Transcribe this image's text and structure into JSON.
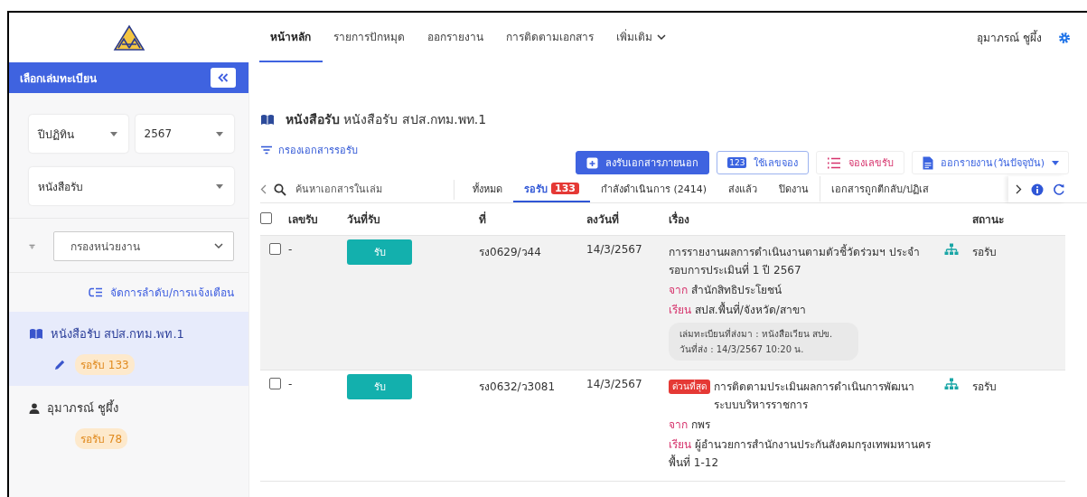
{
  "header": {
    "nav": [
      {
        "label": "หน้าหลัก",
        "selected": true,
        "dropdown": false
      },
      {
        "label": "รายการปักหมุด",
        "selected": false,
        "dropdown": false
      },
      {
        "label": "ออกรายงาน",
        "selected": false,
        "dropdown": false
      },
      {
        "label": "การติดตามเอกสาร",
        "selected": false,
        "dropdown": false
      },
      {
        "label": "เพิ่มเติม",
        "selected": false,
        "dropdown": true
      }
    ],
    "user": "อุมาภรณ์ ชูผึ้ง"
  },
  "sidebar": {
    "title": "เลือกเล่มทะเบียน",
    "selects": [
      {
        "value": "ปีปฏิทิน"
      },
      {
        "value": "2567"
      },
      {
        "value": "หนังสือรับ"
      }
    ],
    "filter": {
      "placeholder": "กรองหน่วยงาน"
    },
    "manage_link": "จัดการลำดับ/การแจ้งเตือน",
    "items": [
      {
        "kind": "book",
        "label": "หนังสือรับ สปส.กทม.พท.1",
        "badge": "รอรับ 133",
        "selected": true
      },
      {
        "kind": "person",
        "label": "อุมาภรณ์ ชูผึ้ง",
        "badge": "รอรับ 78",
        "selected": false
      }
    ]
  },
  "main": {
    "title": "**หนังสือรับ** หนังสือรับ สปส.กทม.พท.1",
    "filter_link": "กรองเอกสารรอรับ",
    "actions": [
      {
        "kind": "primary",
        "label": "ลงรับเอกสารภายนอก"
      },
      {
        "kind": "outline",
        "label": "ใช้เลขจอง",
        "icon_text": "123"
      },
      {
        "kind": "list",
        "label": "จองเลขรับ"
      },
      {
        "kind": "report",
        "label": "ออกรายงาน(วันปัจจุบัน)"
      }
    ],
    "search": {
      "placeholder": "ค้นหาเอกสารในเล่ม"
    },
    "tabs": [
      {
        "label": "ทั้งหมด",
        "selected": false
      },
      {
        "label": "รอรับ",
        "count": "133",
        "selected": true
      },
      {
        "label": "กำลังดำเนินการ (2414)",
        "selected": false
      },
      {
        "label": "ส่งแล้ว",
        "selected": false
      },
      {
        "label": "ปิดงาน",
        "selected": false
      },
      {
        "label": "เอกสารถูกตีกลับ/ปฏิเส",
        "selected": false
      }
    ],
    "table": {
      "select_all_checked": false,
      "columns": [
        "เลขรับ",
        "วันที่รับ",
        "ที่",
        "ลงวันที่",
        "เรื่อง",
        "สถานะ"
      ],
      "rows": [
        {
          "highlighted": true,
          "checked": false,
          "number": "-",
          "action": "รับ",
          "ref": "รง0629/ว44",
          "date": "14/3/2567",
          "subject": "การรายงานผลการดำเนินงานตามตัวชี้วัดร่วมฯ ประจำรอบการประเมินที่ 1 ปี 2567",
          "from_label": "จาก",
          "from": "สำนักสิทธิประโยชน์",
          "to_label": "เรียน",
          "to": "สปส.พื้นที่/จังหวัด/สาขา",
          "note": [
            "เล่มทะเบียนที่ส่งมา : หนังสือเวียน สปข.",
            "วันที่ส่ง : 14/3/2567 10:20 น."
          ],
          "status": "รอรับ"
        },
        {
          "highlighted": false,
          "checked": false,
          "number": "-",
          "action": "รับ",
          "ref": "รง0632/ว3081",
          "date": "14/3/2567",
          "urgent": "ด่วนที่สุด",
          "subject": "การติดตามประเมินผลการดำเนินการพัฒนาระบบบริหารราชการ",
          "from_label": "จาก",
          "from": "กพร",
          "to_label": "เรียน",
          "to": "ผู้อำนวยการสำนักงานประกันสังคมกรุงเทพมหานครพื้นที่ 1-12",
          "status": "รอรับ"
        }
      ]
    }
  }
}
